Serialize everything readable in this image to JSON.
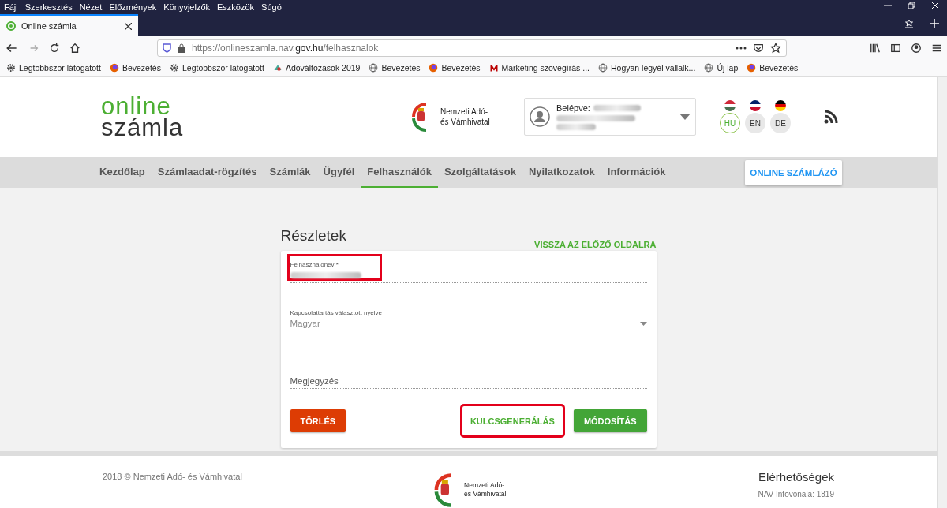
{
  "menu_bar": [
    "Fájl",
    "Szerkesztés",
    "Nézet",
    "Előzmények",
    "Könyvjelzők",
    "Eszközök",
    "Súgó"
  ],
  "tabs": [
    {
      "label": "Online számla",
      "selected": true
    }
  ],
  "address_bar": {
    "prefix": "https://onlineszamla.nav.",
    "domain": "gov.hu",
    "path": "/felhasznalok"
  },
  "bookmarks": [
    {
      "label": "Legtöbbször látogatott",
      "kind": "gear"
    },
    {
      "label": "Bevezetés",
      "kind": "firefox"
    },
    {
      "label": "Legtöbbször látogatott",
      "kind": "gear"
    },
    {
      "label": "Adóváltozások 2019",
      "kind": "site"
    },
    {
      "label": "Bevezetés",
      "kind": "globe"
    },
    {
      "label": "Bevezetés",
      "kind": "firefox"
    },
    {
      "label": "Marketing szövegírás ...",
      "kind": "m"
    },
    {
      "label": "Hogyan legyél vállalk...",
      "kind": "globe"
    },
    {
      "label": "Új lap",
      "kind": "globe"
    },
    {
      "label": "Bevezetés",
      "kind": "firefox"
    }
  ],
  "header": {
    "logo_top": "online",
    "logo_bottom": "számla",
    "agency": [
      "Nemzeti Adó-",
      "és Vámhivatal"
    ],
    "user_label": "Belépve:",
    "languages": [
      {
        "code": "HU",
        "selected": true
      },
      {
        "code": "EN",
        "selected": false
      },
      {
        "code": "DE",
        "selected": false
      }
    ]
  },
  "nav": {
    "items": [
      {
        "label": "Kezdőlap",
        "selected": false
      },
      {
        "label": "Számlaadat-rögzítés",
        "selected": false
      },
      {
        "label": "Számlák",
        "selected": false
      },
      {
        "label": "Ügyfél",
        "selected": false
      },
      {
        "label": "Felhasználók",
        "selected": true
      },
      {
        "label": "Szolgáltatások",
        "selected": false
      },
      {
        "label": "Nyilatkozatok",
        "selected": false
      },
      {
        "label": "Információk",
        "selected": false
      }
    ],
    "cta": "ONLINE SZÁMLÁZÓ"
  },
  "form": {
    "title": "Részletek",
    "back_link": "VISSZA AZ ELŐZŐ OLDALRA",
    "fields": [
      {
        "kind": "text",
        "label": "Felhasználónév *",
        "highlighted": true
      },
      {
        "kind": "select",
        "label": "Kapcsolattartás választott nyelve",
        "value": "Magyar",
        "highlighted": false
      },
      {
        "kind": "textarea",
        "placeholder": "Megjegyzés",
        "highlighted": false
      }
    ],
    "buttons": [
      {
        "label": "TÖRLÉS",
        "kind": "danger",
        "highlighted": false
      },
      {
        "label": "KULCSGENERÁLÁS",
        "kind": "flat",
        "highlighted": true
      },
      {
        "label": "MÓDOSÍTÁS",
        "kind": "primary",
        "highlighted": false
      }
    ]
  },
  "footer": {
    "copyright": "2018 © Nemzeti Adó- és Vámhivatal",
    "agency": [
      "Nemzeti Adó-",
      "és Vámhivatal"
    ],
    "contact_title": "Elérhetőségek",
    "contact_line": "NAV Infovonala: 1819"
  }
}
